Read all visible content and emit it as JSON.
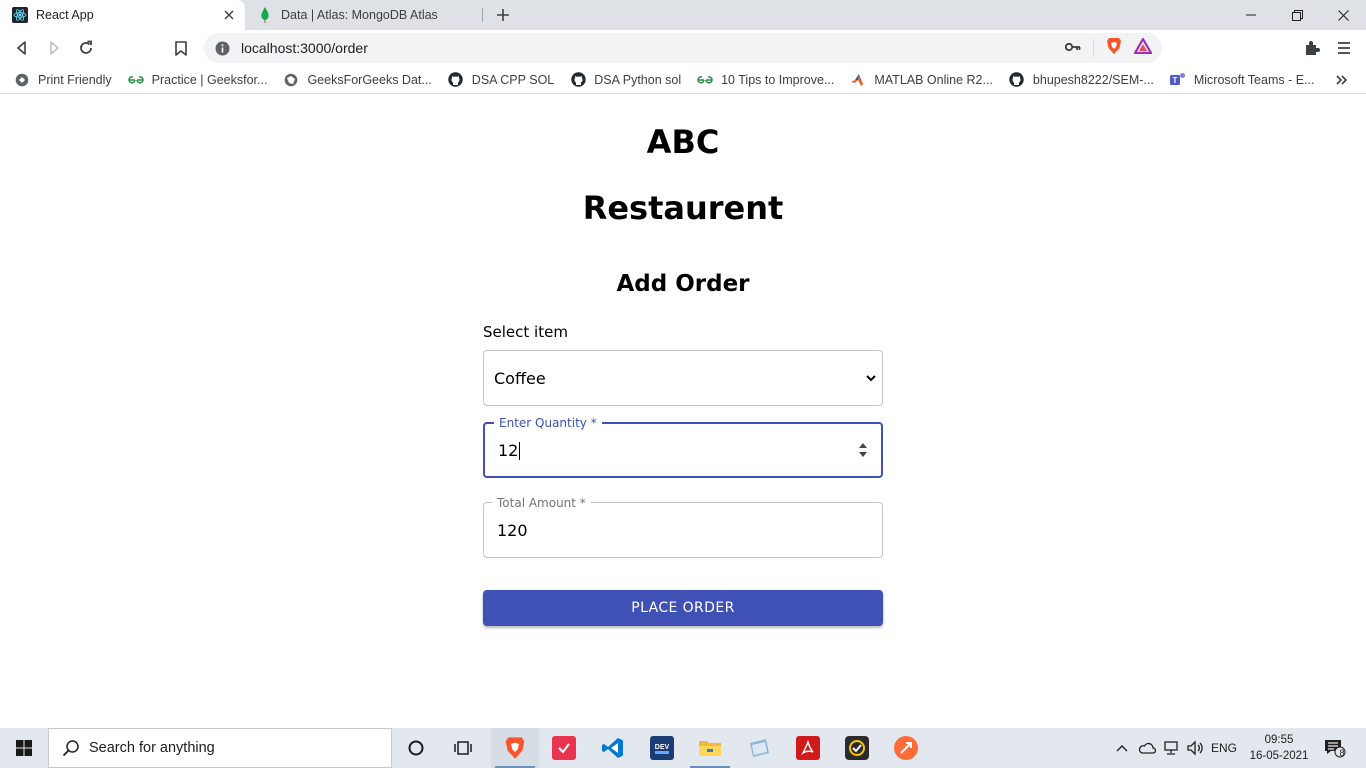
{
  "browser": {
    "tabs": [
      {
        "title": "React App",
        "active": true
      },
      {
        "title": "Data | Atlas: MongoDB Atlas",
        "active": false
      }
    ],
    "url": "localhost:3000/order",
    "bookmarks": [
      {
        "label": "Print Friendly",
        "icon": "print-friendly-icon"
      },
      {
        "label": "Practice | Geeksfor...",
        "icon": "geeksforgeeks-icon"
      },
      {
        "label": "GeeksForGeeks Dat...",
        "icon": "globe-icon"
      },
      {
        "label": "DSA CPP SOL",
        "icon": "github-icon"
      },
      {
        "label": "DSA Python sol",
        "icon": "github-icon"
      },
      {
        "label": "10 Tips to Improve...",
        "icon": "geeksforgeeks-icon"
      },
      {
        "label": "MATLAB Online R2...",
        "icon": "matlab-icon"
      },
      {
        "label": "bhupesh8222/SEM-...",
        "icon": "github-icon"
      },
      {
        "label": "Microsoft Teams - E...",
        "icon": "teams-icon"
      }
    ]
  },
  "page": {
    "title_line1": "ABC",
    "title_line2": "Restaurent",
    "heading": "Add Order",
    "select_label": "Select item",
    "selected_item": "Coffee",
    "quantity_label": "Enter Quantity *",
    "quantity_value": "12",
    "total_label": "Total Amount *",
    "total_value": "120",
    "submit_label": "PLACE ORDER",
    "accent_color": "#3f51b5"
  },
  "taskbar": {
    "search_placeholder": "Search for anything",
    "language": "ENG",
    "time": "09:55",
    "date": "16-05-2021",
    "notification_count": "8"
  }
}
